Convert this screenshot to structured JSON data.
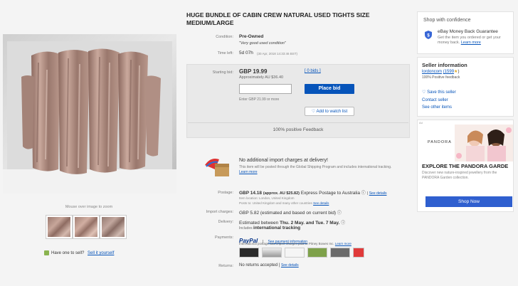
{
  "listing": {
    "title": "HUGE BUNDLE OF CABIN CREW NATURAL USED TIGHTS SIZE MEDIUM/LARGE",
    "condition_label": "Condition:",
    "condition_value": "Pre-Owned",
    "condition_note": "\"Very good used condition\"",
    "time_left_label": "Time left:",
    "time_left_value": "5d 07h",
    "time_left_detail": "(30 Apr, 2018   14:33:46 BST)",
    "starting_bid_label": "Starting bid:",
    "starting_bid_value": "GBP 19.99",
    "approx_value": "Approximately AU $36.40",
    "bids_link": "[ 0 bids ]",
    "enter_hint": "Enter GBP 21.99 or more",
    "place_bid_label": "Place bid",
    "watch_label": "Add to watch list",
    "positive_feedback": "100% positive Feedback"
  },
  "gsp": {
    "title": "No additional import charges at delivery!",
    "desc": "This item will be posted through the Global Shipping Program and includes international tracking.",
    "learn_more": "Learn more"
  },
  "postage": {
    "label": "Postage:",
    "value": "GBP 14.18",
    "approx": "(approx. AU $25.82)",
    "service": "Express Postage to Australia",
    "details_link": "See details",
    "item_location": "Item location: London, United Kingdom",
    "posts_to": "Posts to: United Kingdom and many other countries",
    "posts_to_link": "See details"
  },
  "import": {
    "label": "Import charges:",
    "value": "GBP 5.82 (estimated and based on current bid)"
  },
  "delivery": {
    "label": "Delivery:",
    "prefix": "Estimated between",
    "dates": "Thu. 2 May. and Tue. 7 May.",
    "includes_prefix": "Includes",
    "includes_bold": "international tracking"
  },
  "payments": {
    "label": "Payments:",
    "paypal": "PayPal",
    "separator": "|",
    "details_link": "See payment information",
    "note": "International postage and import charges paid to Pitney Bowes Inc.",
    "note_link": "Learn more"
  },
  "returns": {
    "label": "Returns:",
    "value": "No returns accepted",
    "separator": "|",
    "details_link": "See details"
  },
  "left": {
    "hover_hint": "Mouse over image to zoom",
    "sell_prefix": "Have one to sell?",
    "sell_link": "Sell it yourself"
  },
  "confidence": {
    "heading": "Shop with confidence",
    "guarantee_title": "eBay Money Back Guarantee",
    "guarantee_desc": "Get the item you ordered or get your money back.",
    "learn_more": "Learn more"
  },
  "seller": {
    "heading": "Seller information",
    "name": "lordoncom",
    "score": "(1599",
    "score_end": ")",
    "feedback": "100% Positive feedback",
    "save": "Save this seller",
    "contact": "Contact seller",
    "other_items": "See other items"
  },
  "ad": {
    "brand": "PANDORA",
    "badge": "Ad",
    "headline": "EXPLORE THE PANDORA GARDE",
    "desc": "Discover new nature-inspired jewellery from the PANDORA Garden collection.",
    "cta": "Shop Now"
  },
  "colors": {
    "accent": "#0654ba",
    "paypal_blue": "#003087",
    "paypal_light": "#009cde"
  }
}
